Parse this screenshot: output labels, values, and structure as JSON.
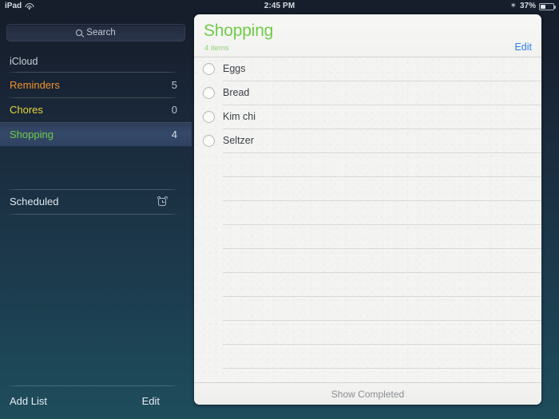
{
  "statusbar": {
    "device": "iPad",
    "wifi_icon": "wifi-icon",
    "time": "2:45 PM",
    "bluetooth_icon": "bluetooth-icon",
    "battery_percent": "37%",
    "battery_icon": "battery-icon",
    "battery_level": 37
  },
  "sidebar": {
    "search": {
      "icon": "search-icon",
      "placeholder": "Search",
      "value": ""
    },
    "account_section": "iCloud",
    "lists": [
      {
        "name": "Reminders",
        "count": "5",
        "color": "#f0922b",
        "selected": false
      },
      {
        "name": "Chores",
        "count": "0",
        "color": "#e6d53a",
        "selected": false
      },
      {
        "name": "Shopping",
        "count": "4",
        "color": "#6fcc48",
        "selected": true
      }
    ],
    "scheduled": {
      "label": "Scheduled",
      "icon": "alarm-clock-icon"
    },
    "add_list_label": "Add List",
    "edit_label": "Edit"
  },
  "main": {
    "title": "Shopping",
    "title_color": "#6fcc48",
    "subtitle": "4 items",
    "edit_label": "Edit",
    "edit_color": "#2b7ef0",
    "reminders": [
      {
        "text": "Eggs",
        "completed": false
      },
      {
        "text": "Bread",
        "completed": false
      },
      {
        "text": "Kim chi",
        "completed": false
      },
      {
        "text": "Seltzer",
        "completed": false
      }
    ],
    "blank_line_count": 10,
    "show_completed_label": "Show Completed"
  }
}
